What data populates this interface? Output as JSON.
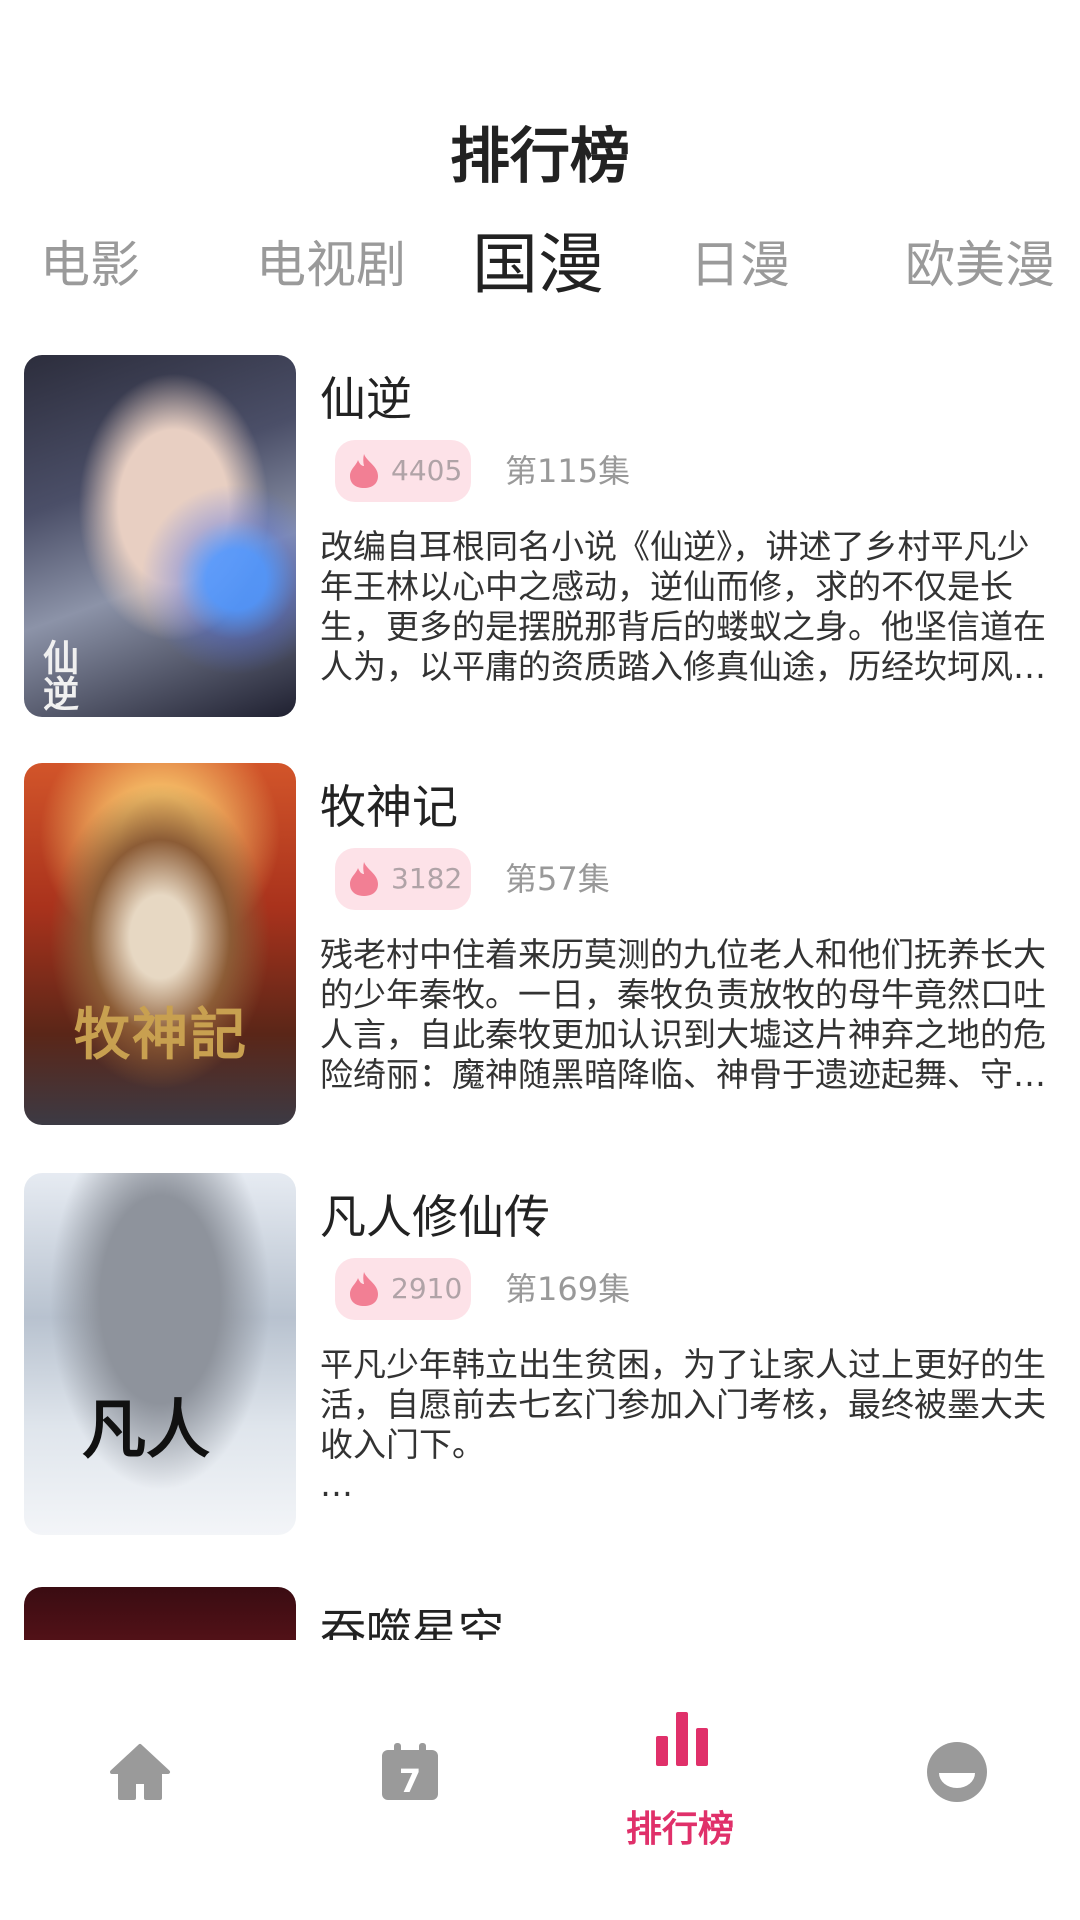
{
  "header": {
    "title": "排行榜"
  },
  "tabs": [
    {
      "label": "电影",
      "active": false
    },
    {
      "label": "电视剧",
      "active": false
    },
    {
      "label": "国漫",
      "active": true
    },
    {
      "label": "日漫",
      "active": false
    },
    {
      "label": "欧美漫",
      "active": false
    }
  ],
  "items": [
    {
      "title": "仙逆",
      "poster_text": "仙逆",
      "hot_count": "4405",
      "episode": "第115集",
      "description": "改编自耳根同名小说《仙逆》，讲述了乡村平凡少年王林以心中之感动，逆仙而修，求的不仅是长生，更多的是摆脱那背后的蝼蚁之身。他坚信道在人为，以平庸的资质踏入修真仙途，历经坎坷风…"
    },
    {
      "title": "牧神记",
      "poster_text": "牧神記",
      "hot_count": "3182",
      "episode": "第57集",
      "description": "残老村中住着来历莫测的九位老人和他们抚养长大的少年秦牧。一日，秦牧负责放牧的母牛竟然口吐人言，自此秦牧更加认识到大墟这片神弃之地的危险绮丽：魔神随黑暗降临、神骨于遗迹起舞、守…"
    },
    {
      "title": "凡人修仙传",
      "poster_text": "凡人",
      "hot_count": "2910",
      "episode": "第169集",
      "description": "平凡少年韩立出生贫困，为了让家人过上更好的生活，自愿前去七玄门参加入门考核，最终被墨大夫收入门下。",
      "ellipsis": "…"
    },
    {
      "title": "吞噬星空"
    }
  ],
  "bottom_nav": {
    "rank_label": "排行榜",
    "calendar_day": "7"
  },
  "colors": {
    "accent": "#e0306a",
    "nav_inactive": "#9a9a9a",
    "badge_bg": "#fde2e8",
    "flame": "#f27f94"
  }
}
